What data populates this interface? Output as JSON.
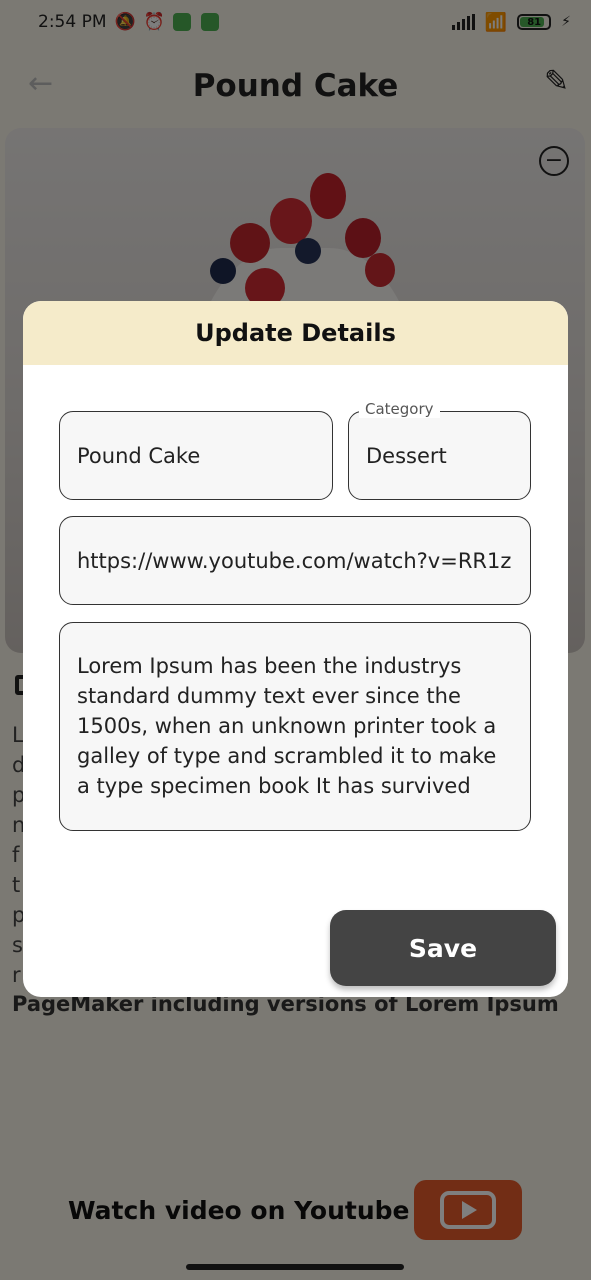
{
  "status_bar": {
    "time": "2:54 PM",
    "battery": "81"
  },
  "app_bar": {
    "title": "Pound Cake"
  },
  "description_background": {
    "first_letters": [
      "L",
      "d",
      "p",
      "n",
      "f",
      "t",
      "p",
      "s",
      "r"
    ],
    "last_line": "PageMaker including versions of Lorem Ipsum"
  },
  "youtube": {
    "label": "Watch video on Youtube"
  },
  "dialog": {
    "title": "Update Details",
    "name_value": "Pound Cake",
    "category_label": "Category",
    "category_value": "Dessert",
    "url_value": "https://www.youtube.com/watch?v=RR1z",
    "description_value": "Lorem Ipsum has been the industrys standard dummy text ever since the 1500s, when an unknown printer took a galley of type and scrambled it to make a type specimen book It has survived",
    "save_label": "Save"
  },
  "colors": {
    "dialog_header": "#f5ebca",
    "save_button": "#444444",
    "youtube_button": "#e55a2b",
    "background": "#f7f2e6"
  },
  "icons": [
    "back-arrow-icon",
    "edit-pencil-icon",
    "remove-circle-icon",
    "youtube-play-icon",
    "wifi-icon",
    "alarm-icon",
    "mute-icon"
  ]
}
